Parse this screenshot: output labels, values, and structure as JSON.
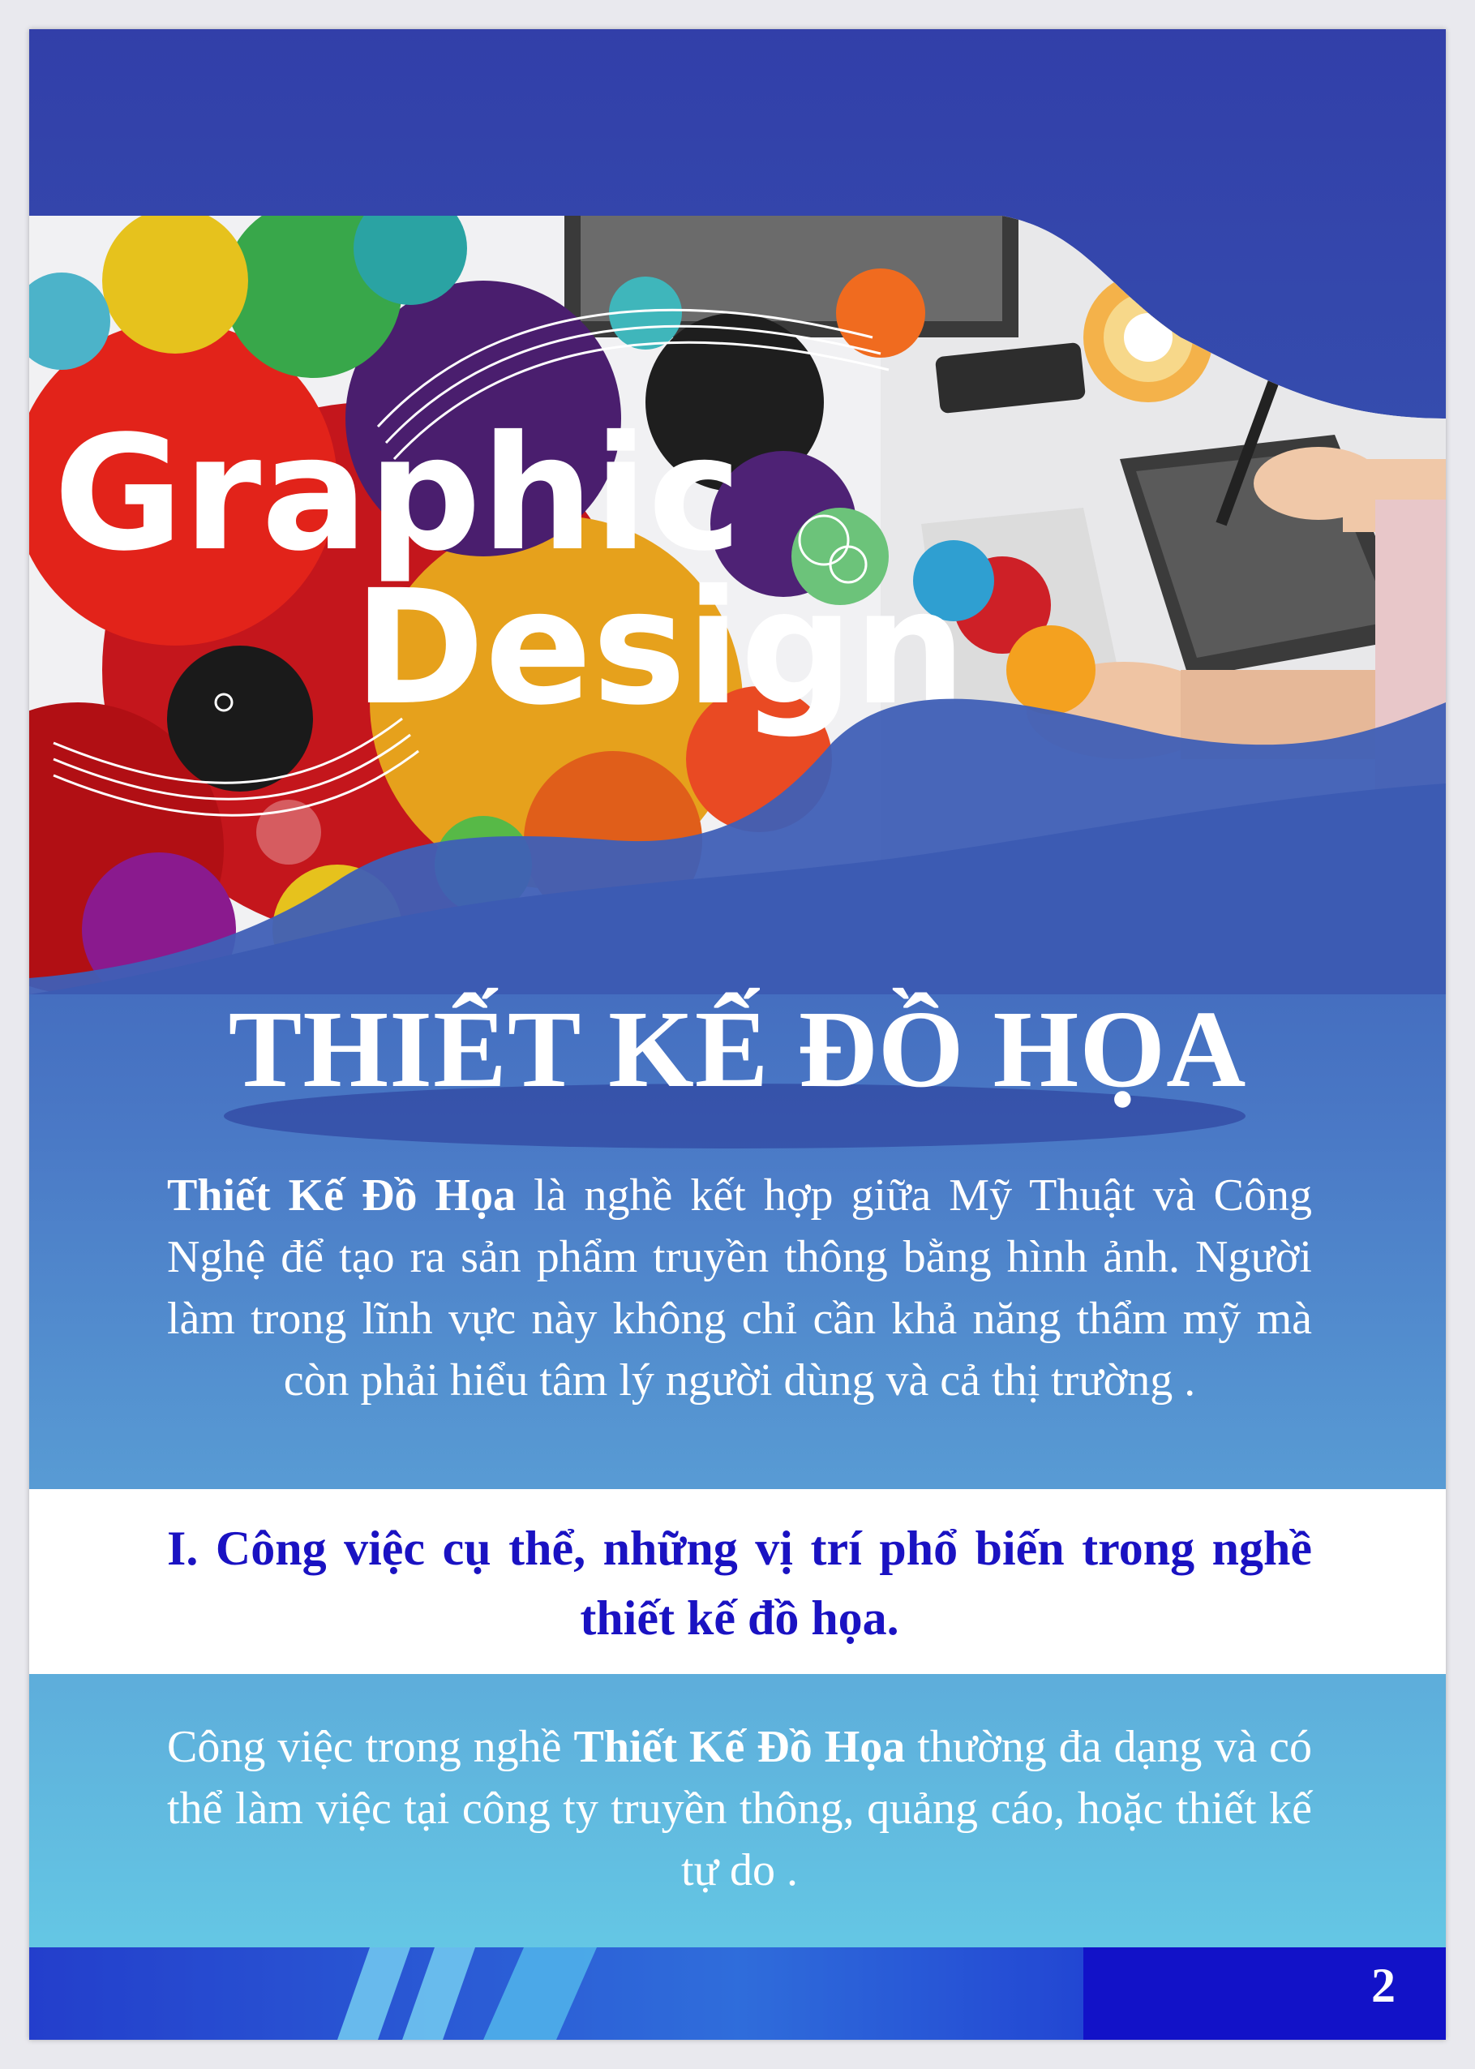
{
  "hero": {
    "line1": "Graphic",
    "line2": "Design"
  },
  "title": "THIẾT KẾ ĐỒ HỌA",
  "intro": {
    "bold_lead": "Thiết Kế Đồ Họa",
    "rest": " là nghề kết hợp giữa Mỹ Thuật và Công Nghệ để tạo ra sản phẩm truyền thông bằng hình ảnh. Người làm trong lĩnh vực này không chỉ cần khả năng thẩm mỹ mà còn phải hiểu tâm lý người dùng và cả thị trường ."
  },
  "section": {
    "heading": "I. Công việc cụ thể, những vị trí phổ biến trong nghề thiết kế đồ họa."
  },
  "body2": {
    "before": "Công việc trong nghề ",
    "bold": "Thiết Kế Đồ Họa",
    "after": " thường đa dạng và có thể làm việc tại công ty truyền thông, quảng cáo, hoặc thiết kế tự do ."
  },
  "page_number": "2",
  "colors": {
    "page_top": "#323fa9",
    "page_bottom": "#66d0e8",
    "heading_blue": "#1a12c2",
    "white": "#ffffff"
  }
}
